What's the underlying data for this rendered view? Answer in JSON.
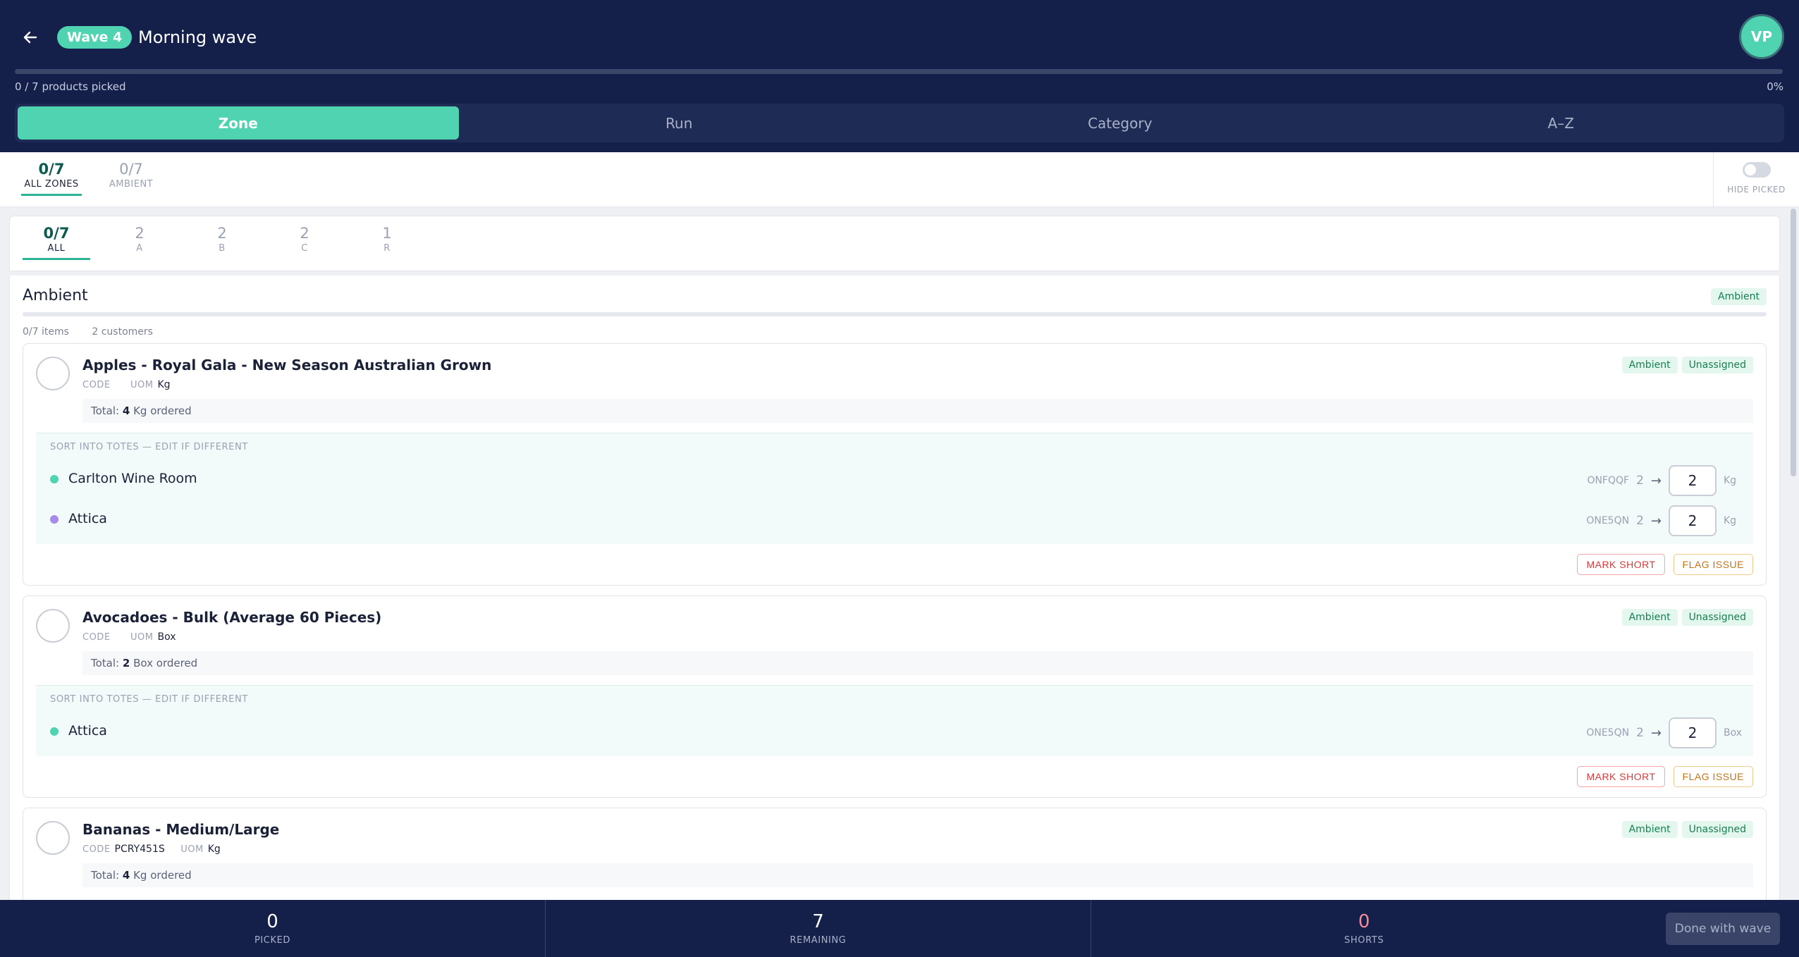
{
  "header": {
    "wave_badge": "Wave 4",
    "title": "Morning wave",
    "avatar": "VP",
    "progress_text": "0 / 7 products picked",
    "progress_pct": "0%",
    "progress_fraction": 0,
    "sort_tabs": [
      "Zone",
      "Run",
      "Category",
      "A–Z"
    ]
  },
  "zones": {
    "tabs": [
      {
        "num": "0/7",
        "label": "ALL ZONES"
      },
      {
        "num": "0/7",
        "label": "AMBIENT"
      }
    ],
    "hide_picked": "HIDE PICKED"
  },
  "aisles": [
    {
      "num": "0/7",
      "label": "ALL"
    },
    {
      "num": "2",
      "label": "A"
    },
    {
      "num": "2",
      "label": "B"
    },
    {
      "num": "2",
      "label": "C"
    },
    {
      "num": "1",
      "label": "R"
    }
  ],
  "zone_panel": {
    "name": "Ambient",
    "tag": "Ambient",
    "items": "0/7 items",
    "customers": "2 customers"
  },
  "labels": {
    "code": "CODE",
    "uom": "UOM",
    "total_prefix": "Total:",
    "ordered": "ordered",
    "sort_title": "SORT INTO TOTES — EDIT IF DIFFERENT",
    "mark_short": "MARK SHORT",
    "flag_issue": "FLAG ISSUE",
    "arrow": "→"
  },
  "products": [
    {
      "name": "Apples - Royal Gala - New Season Australian Grown",
      "code": "",
      "uom": "Kg",
      "total": "4",
      "tags": [
        "Ambient",
        "Unassigned"
      ],
      "totes": [
        {
          "customer": "Carlton Wine Room",
          "dot": "#4fd3b0",
          "code": "ONFQQF",
          "qty": "2",
          "value": "2"
        },
        {
          "customer": "Attica",
          "dot": "#a78bea",
          "code": "ONE5QN",
          "qty": "2",
          "value": "2"
        }
      ]
    },
    {
      "name": "Avocadoes - Bulk (Average 60 Pieces)",
      "code": "",
      "uom": "Box",
      "total": "2",
      "tags": [
        "Ambient",
        "Unassigned"
      ],
      "totes": [
        {
          "customer": "Attica",
          "dot": "#4fd3b0",
          "code": "ONE5QN",
          "qty": "2",
          "value": "2"
        }
      ]
    },
    {
      "name": "Bananas - Medium/Large",
      "code": "PCRY451S",
      "uom": "Kg",
      "total": "4",
      "tags": [
        "Ambient",
        "Unassigned"
      ],
      "totes": []
    }
  ],
  "footer": {
    "picked": "0",
    "picked_label": "PICKED",
    "remaining": "7",
    "remaining_label": "REMAINING",
    "shorts": "0",
    "shorts_label": "SHORTS",
    "done": "Done with wave"
  }
}
